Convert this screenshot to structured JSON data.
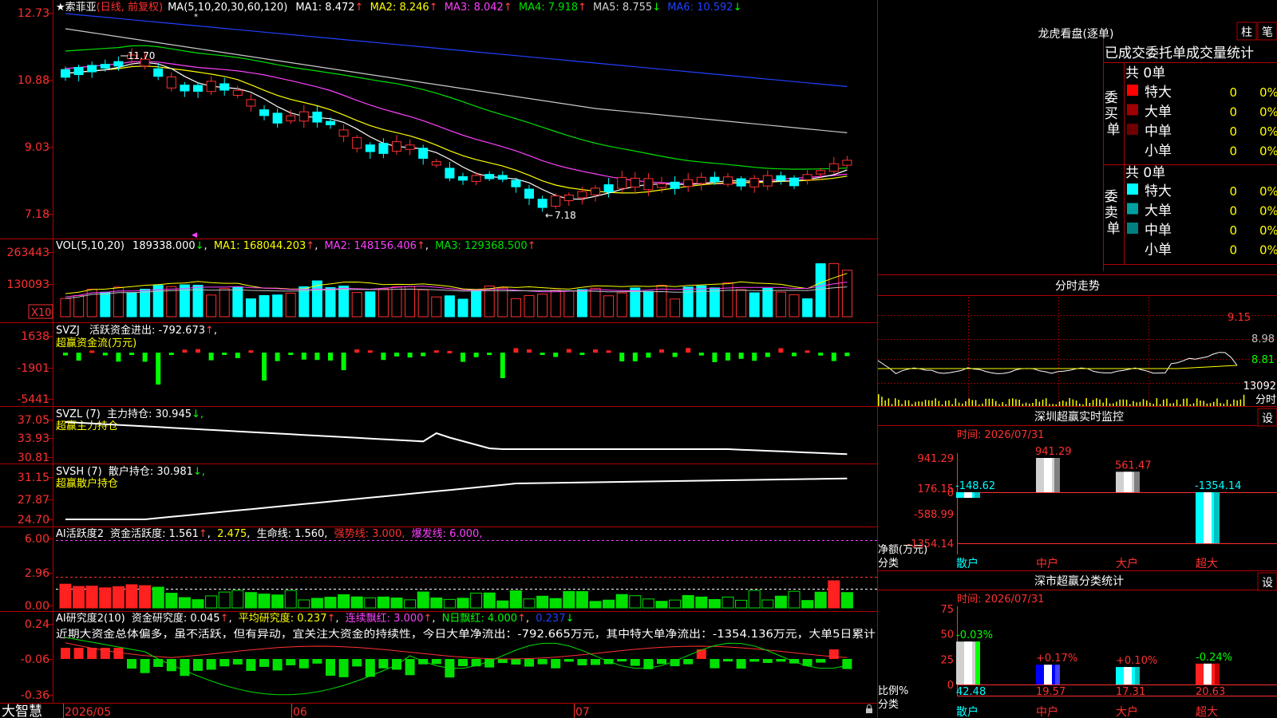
{
  "app_name": "大智慧",
  "kline": {
    "star": "★",
    "stock_name": "索菲亚",
    "period": "(日线, 前复权)",
    "ma_header": "MA(5,10,20,30,60,120)",
    "ma_values": [
      {
        "text": "MA1: 8.472",
        "color": "#ffffff",
        "arrow": "↑",
        "arrow_color": "#ff4040"
      },
      {
        "text": "MA2: 8.246",
        "color": "#ffff00",
        "arrow": "↑",
        "arrow_color": "#ff4040"
      },
      {
        "text": "MA3: 8.042",
        "color": "#ff40ff",
        "arrow": "↑",
        "arrow_color": "#ff4040"
      },
      {
        "text": "MA4: 7.918",
        "color": "#00e000",
        "arrow": "↑",
        "arrow_color": "#ff4040"
      },
      {
        "text": "MA5: 8.755",
        "color": "#d0d0d0",
        "arrow": "↓",
        "arrow_color": "#00ff00"
      },
      {
        "text": "MA6: 10.592",
        "color": "#2040ff",
        "arrow": "↓",
        "arrow_color": "#00ff00"
      }
    ],
    "y_ticks": [
      "12.73",
      "10.88",
      "9.03",
      "7.18"
    ],
    "high_label": "11.70",
    "low_label": "7.18",
    "colors": {
      "up": "#ff3030",
      "down": "#00ffff",
      "ma1": "#ffffff",
      "ma2": "#ffff00",
      "ma3": "#ff40ff",
      "ma4": "#00e000",
      "ma5": "#c8c8c8",
      "ma6": "#2040ff"
    }
  },
  "vol": {
    "header": "VOL(5,10,20)",
    "value": "189338.000",
    "value_arrow": "↓",
    "ma1": "MA1: 168044.203",
    "ma2": "MA2: 148156.406",
    "ma3": "MA3: 129368.500",
    "arrow": "↑",
    "y_ticks": [
      "263443",
      "130093"
    ],
    "unit": "X10"
  },
  "svzj": {
    "header": "SVZJ",
    "title": "活跃资金进出: -792.673",
    "arrow": "↑",
    "subtitle": "超赢资金流(万元)",
    "y_ticks": [
      "1638",
      "-1901",
      "-5441"
    ]
  },
  "svzl": {
    "header": "SVZL (7)",
    "title": "主力持仓: 30.945",
    "arrow": "↓,",
    "subtitle": "超赢主力持仓",
    "y_ticks": [
      "37.05",
      "33.93",
      "30.81"
    ]
  },
  "svsh": {
    "header": "SVSH (7)",
    "title": "散户持仓: 30.981",
    "arrow": "↓,",
    "subtitle": "超赢散户持仓",
    "y_ticks": [
      "31.15",
      "27.87",
      "24.70"
    ]
  },
  "ai1": {
    "header": "AI活跃度2",
    "active": "资金活跃度: 1.561",
    "v2": "2.475",
    "life": "生命线: 1.560,",
    "strong": "强势线: 3.000,",
    "burst": "爆发线: 6.000,",
    "y_ticks": [
      "6.00",
      "2.96",
      "0.00"
    ]
  },
  "ai2": {
    "header": "AI研究度2(10)",
    "research": "资金研究度: 0.045",
    "avg": "平均研究度: 0.237",
    "cont": "连续飘红: 3.000",
    "nday": "N日飘红: 4.000",
    "v5": "0.237",
    "comment": "近期大资金总体偏多，虽不活跃，但有异动，宜关注大资金的持续性，今日大单净流出：-792.665万元，其中特大单净流出：-1354.136万元，大单5日累计",
    "y_ticks": [
      "0.24",
      "-0.06",
      "-0.36"
    ]
  },
  "x_axis": [
    "2026/05",
    "06",
    "07"
  ],
  "right": {
    "dragon_title": "龙虎看盘(逐单)",
    "tab1": "柱",
    "tab2": "笔",
    "stats_title": "已成交委托单成交量统计",
    "buy": {
      "side": "委买单",
      "total": "共 0单",
      "rows": [
        {
          "label": "特大",
          "count": "0",
          "pct": "0%",
          "color": "#ff0000"
        },
        {
          "label": "大单",
          "count": "0",
          "pct": "0%",
          "color": "#a00000"
        },
        {
          "label": "中单",
          "count": "0",
          "pct": "0%",
          "color": "#700000"
        },
        {
          "label": "小单",
          "count": "0",
          "pct": "0%",
          "color": ""
        }
      ]
    },
    "sell": {
      "side": "委卖单",
      "total": "共 0单",
      "rows": [
        {
          "label": "特大",
          "count": "0",
          "pct": "0%",
          "color": "#00ffff"
        },
        {
          "label": "大单",
          "count": "0",
          "pct": "0%",
          "color": "#00a0a0"
        },
        {
          "label": "中单",
          "count": "0",
          "pct": "0%",
          "color": "#008080"
        },
        {
          "label": "小单",
          "count": "0",
          "pct": "0%",
          "color": ""
        }
      ]
    },
    "fenshi": {
      "title": "分时走势",
      "prices": [
        "9.15",
        "8.98",
        "8.81"
      ],
      "volume": "13092",
      "vol_label": "分时"
    },
    "sz_monitor": {
      "title": "深圳超赢实时监控",
      "set": "设",
      "time": "时间: 2026/07/31",
      "y_ticks": [
        "941.29",
        "176.15",
        "0",
        "-588.99",
        "-1354.14"
      ],
      "ylabel": "净额(万元)",
      "xlabel": "分类",
      "categories": [
        "散户",
        "中户",
        "大户",
        "超大"
      ],
      "values": [
        -148.62,
        941.29,
        561.47,
        -1354.14
      ],
      "value_labels": [
        "-148.62",
        "941.29",
        "561.47",
        "-1354.14"
      ]
    },
    "sz_class": {
      "title": "深市超赢分类统计",
      "set": "设",
      "time": "时间: 2026/07/31",
      "y_ticks": [
        "75",
        "50",
        "25",
        "0"
      ],
      "ylabel": "比例%",
      "xlabel": "分类",
      "categories": [
        "散户",
        "中户",
        "大户",
        "超大"
      ],
      "values": [
        42.48,
        19.57,
        17.31,
        20.63
      ],
      "changes": [
        "-0.03%",
        "+0.17%",
        "+0.10%",
        "-0.24%"
      ]
    }
  }
}
